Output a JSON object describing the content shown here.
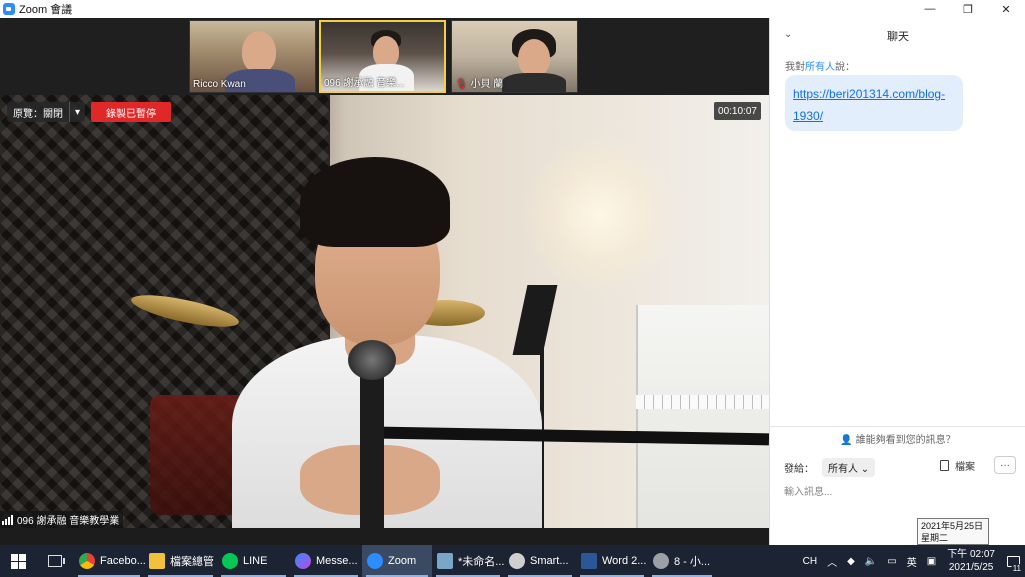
{
  "window": {
    "title": "Zoom 會議",
    "minimize": "—",
    "restore": "❐",
    "close": "✕"
  },
  "participants": [
    {
      "name": "Ricco Kwan"
    },
    {
      "name": "096 謝承融 音樂..."
    },
    {
      "name": "小貝 蘭"
    }
  ],
  "toolbar": {
    "view_label": "原覽：關閉",
    "view_caret": "▾",
    "recording_label": "錄製已暫停",
    "timer": "00:10:07"
  },
  "active_speaker": {
    "name": "096 謝承融 音樂教學業"
  },
  "chat": {
    "title": "聊天",
    "collapse": "⌄",
    "meta_prefix": "我對",
    "meta_target": "所有人",
    "meta_suffix": "說：",
    "message_link": "https://beri201314.com/blog-1930/",
    "who_can_see": "誰能夠看到您的訊息？",
    "send_to_label": "發給：",
    "send_to_value": "所有人",
    "file_label": "檔案",
    "more_label": "···",
    "input_placeholder": "輸入訊息..."
  },
  "tooltip": {
    "line1": "2021年5月25日",
    "line2": "星期二"
  },
  "taskbar": {
    "apps": [
      {
        "label": "Facebo...",
        "icon_color": "#e94235",
        "active": false
      },
      {
        "label": "檔案總管",
        "icon_color": "#f2c13c",
        "active": false
      },
      {
        "label": "LINE",
        "icon_color": "#06c755",
        "active": false
      },
      {
        "label": "Messe...",
        "icon_color": "#7f5df0",
        "active": false
      },
      {
        "label": "Zoom",
        "icon_color": "#2d8cff",
        "active": true
      },
      {
        "label": "*未命名...",
        "icon_color": "#7aa7c7",
        "active": false
      },
      {
        "label": "Smart...",
        "icon_color": "#cfcfcf",
        "active": false
      },
      {
        "label": "Word 2...",
        "icon_color": "#2b5797",
        "active": false
      },
      {
        "label": "8 - 小...",
        "icon_color": "#9aa0a6",
        "active": false
      }
    ],
    "tray": {
      "lang": "CH",
      "ime": "英",
      "time": "下午 02:07",
      "date": "2021/5/25",
      "notifications": "11"
    }
  }
}
